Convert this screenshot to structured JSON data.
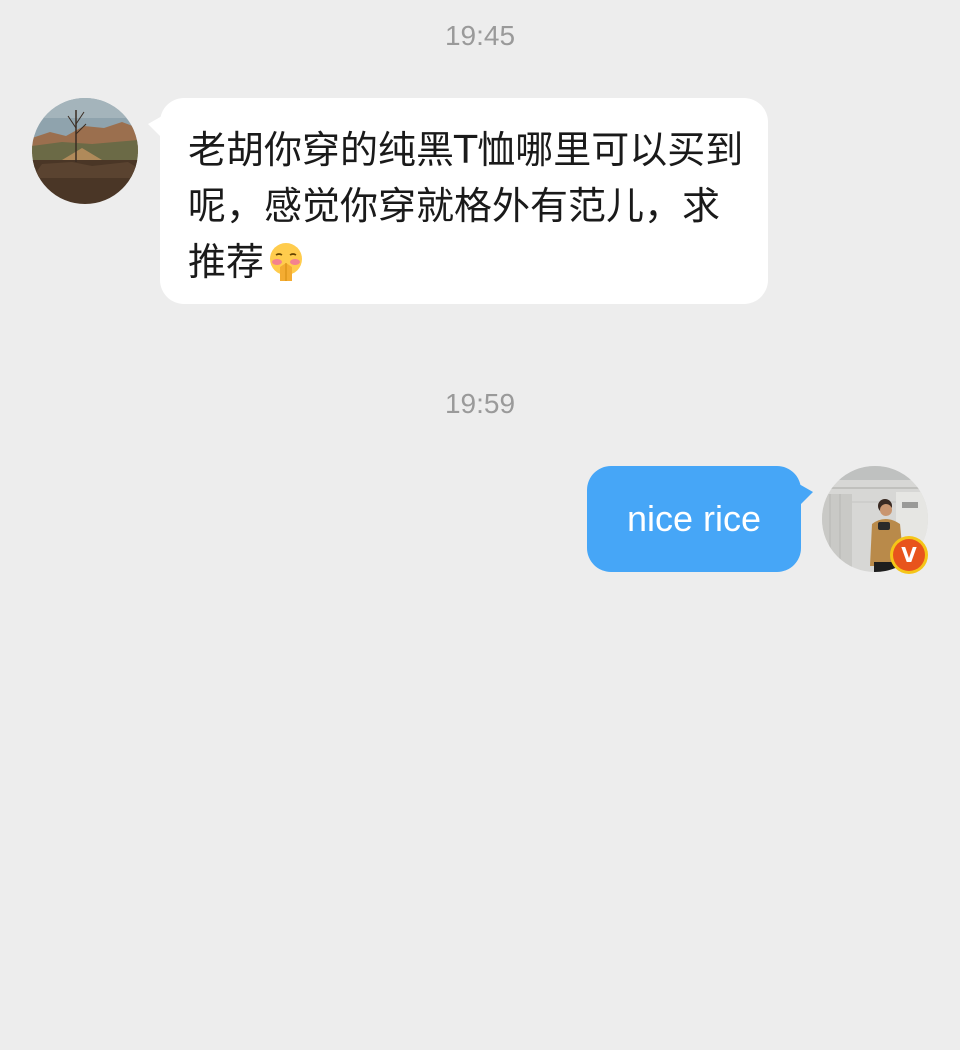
{
  "messages": [
    {
      "timestamp": "19:45",
      "sender": "other",
      "text": "老胡你穿的纯黑T恤哪里可以买到呢，感觉你穿就格外有范儿，求推荐",
      "emoji": "flushed-pleading-hands-emoji"
    },
    {
      "timestamp": "19:59",
      "sender": "self",
      "text": "nice rice",
      "verified_badge": "V"
    }
  ],
  "colors": {
    "background": "#ededed",
    "incoming_bubble": "#ffffff",
    "outgoing_bubble": "#46a6f7",
    "timestamp_text": "#9a9a9a",
    "badge_ring": "#f5c518",
    "badge_fill": "#e8541c"
  }
}
